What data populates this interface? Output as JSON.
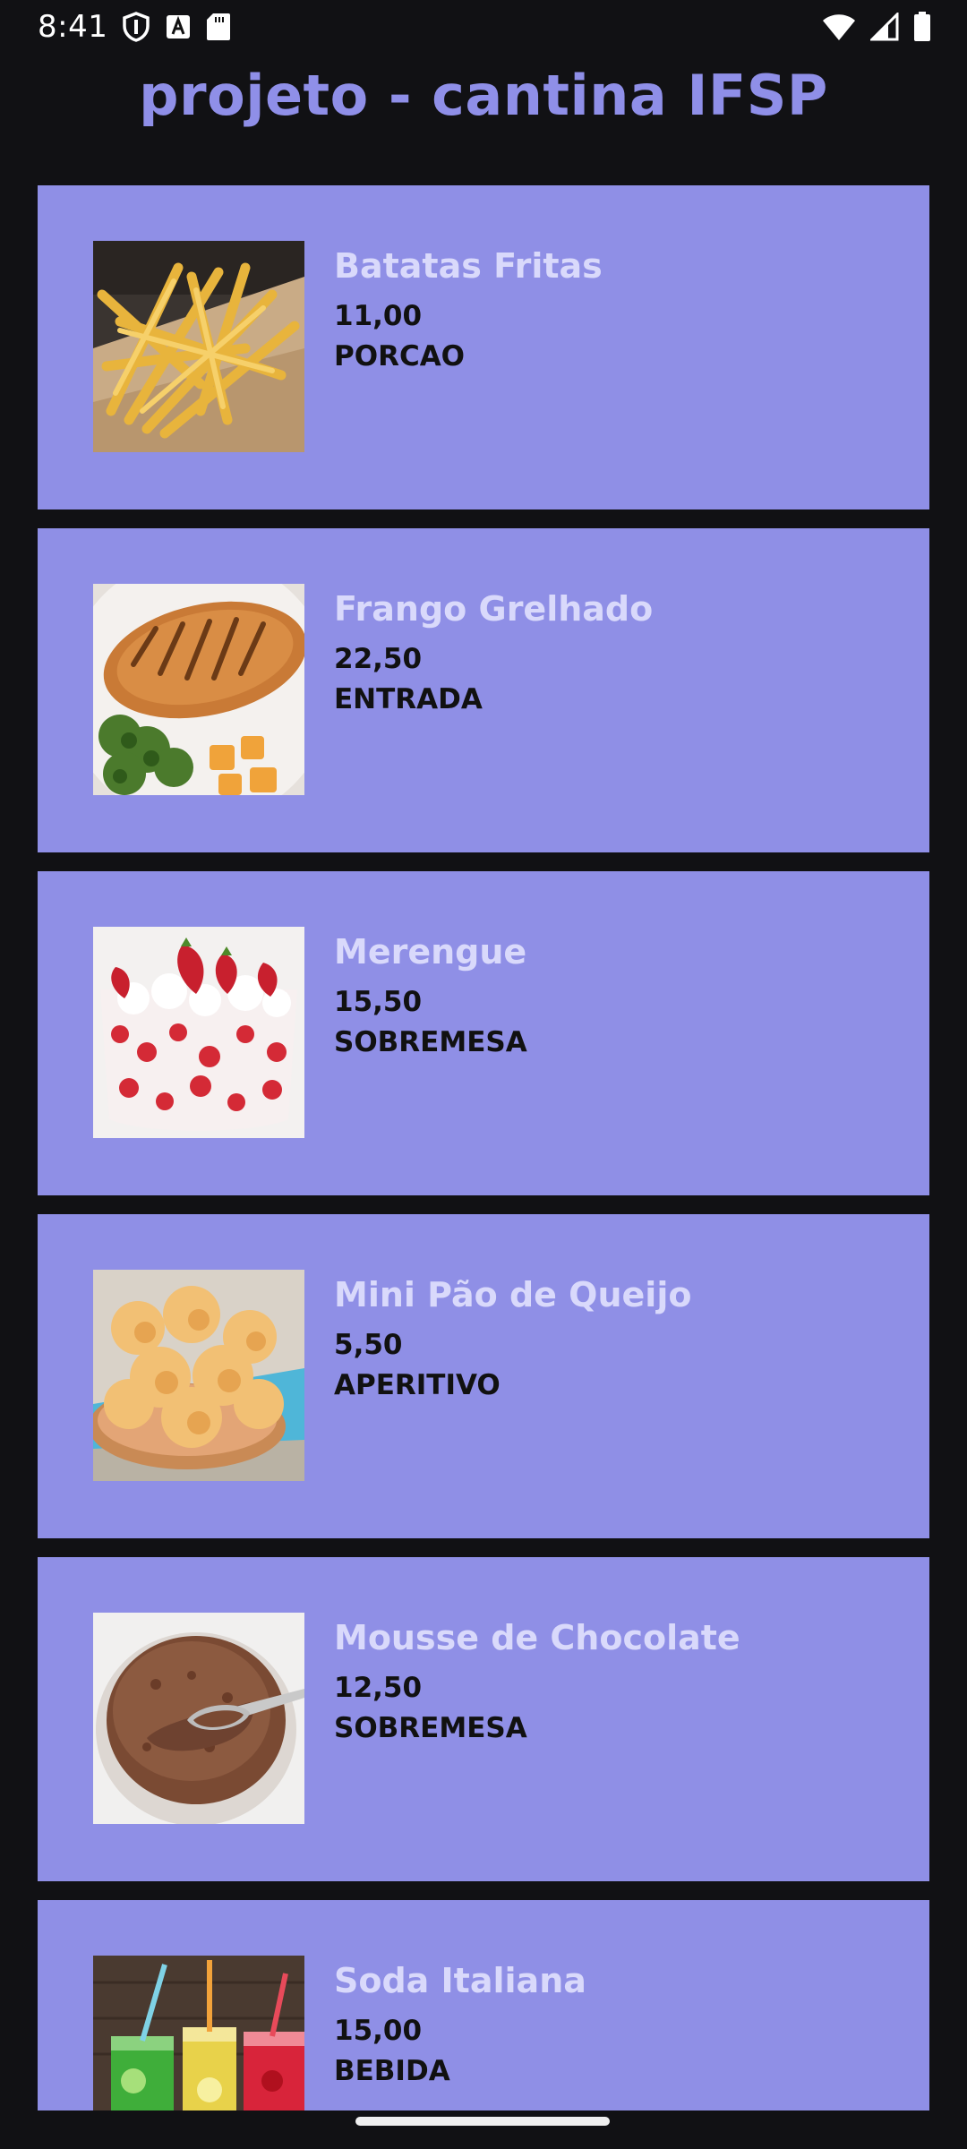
{
  "status_bar": {
    "time": "8:41",
    "icons": [
      "shield-icon",
      "text-a-icon",
      "sd-card-icon",
      "wifi-icon",
      "signal-icon",
      "battery-icon"
    ]
  },
  "app": {
    "title": "projeto - cantina IFSP"
  },
  "colors": {
    "background": "#111114",
    "card": "#8f8fe6",
    "title": "#8f8fe8",
    "item_name": "#d9d9fb",
    "item_text": "#111111"
  },
  "items": [
    {
      "name": "Batatas Fritas",
      "price": "11,00",
      "category": "PORCAO",
      "image": "fries-image"
    },
    {
      "name": "Frango Grelhado",
      "price": "22,50",
      "category": "ENTRADA",
      "image": "grilled-chicken-image"
    },
    {
      "name": "Merengue",
      "price": "15,50",
      "category": "SOBREMESA",
      "image": "meringue-image"
    },
    {
      "name": "Mini Pão de Queijo",
      "price": "5,50",
      "category": "APERITIVO",
      "image": "cheese-bread-image"
    },
    {
      "name": "Mousse de Chocolate",
      "price": "12,50",
      "category": "SOBREMESA",
      "image": "chocolate-mousse-image"
    },
    {
      "name": "Soda Italiana",
      "price": "15,00",
      "category": "BEBIDA",
      "image": "italian-soda-image"
    }
  ]
}
